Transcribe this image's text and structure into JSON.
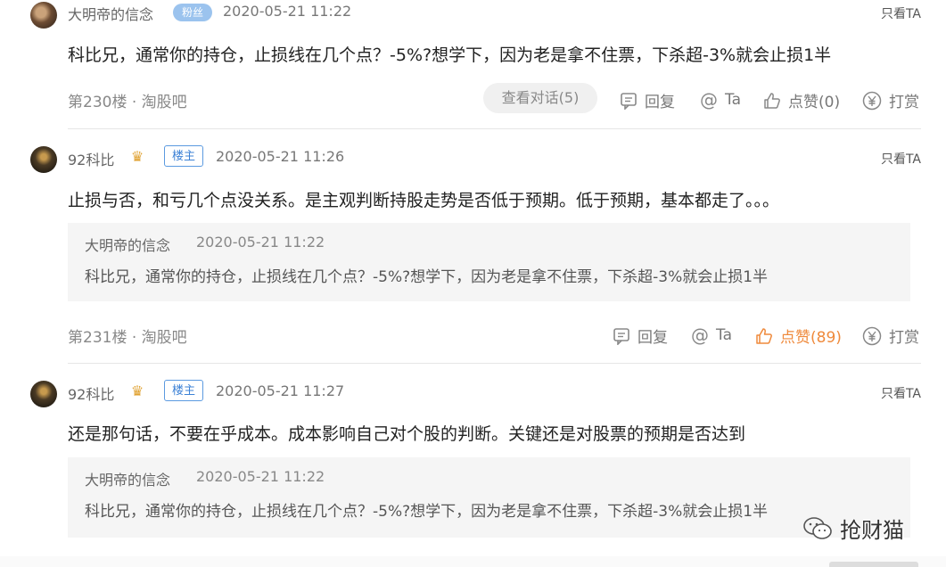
{
  "posts": [
    {
      "user": "大明帝的信念",
      "badge": "粉丝",
      "time": "2020-05-21 11:22",
      "only_ta": "只看TA",
      "content": "科比兄，通常你的持仓，止损线在几个点？-5%?想学下，因为老是拿不住票，下杀超-3%就会止损1半",
      "floor": "第230楼 · 淘股吧",
      "dialog_button": "查看对话(5)",
      "reply": "回复",
      "at": "Ta",
      "like": "点赞(0)",
      "tip": "打赏"
    },
    {
      "user": "92科比",
      "badge": "楼主",
      "time": "2020-05-21 11:26",
      "only_ta": "只看TA",
      "content": "止损与否，和亏几个点没关系。是主观判断持股走势是否低于预期。低于预期，基本都走了。。。",
      "quote": {
        "user": "大明帝的信念",
        "time": "2020-05-21 11:22",
        "text": "科比兄，通常你的持仓，止损线在几个点？-5%?想学下，因为老是拿不住票，下杀超-3%就会止损1半"
      },
      "floor": "第231楼 · 淘股吧",
      "reply": "回复",
      "at": "Ta",
      "like": "点赞(89)",
      "tip": "打赏"
    },
    {
      "user": "92科比",
      "badge": "楼主",
      "time": "2020-05-21 11:27",
      "only_ta": "只看TA",
      "content": "还是那句话，不要在乎成本。成本影响自己对个股的判断。关键还是对股票的预期是否达到",
      "quote": {
        "user": "大明帝的信念",
        "time": "2020-05-21 11:22",
        "text": "科比兄，通常你的持仓，止损线在几个点？-5%?想学下，因为老是拿不住票，下杀超-3%就会止损1半"
      }
    }
  ],
  "watermark": "抢财猫",
  "colors": {
    "liked": "#ef8a3c",
    "host_badge": "#3d82d6",
    "fan_badge": "#9bc3ee"
  }
}
